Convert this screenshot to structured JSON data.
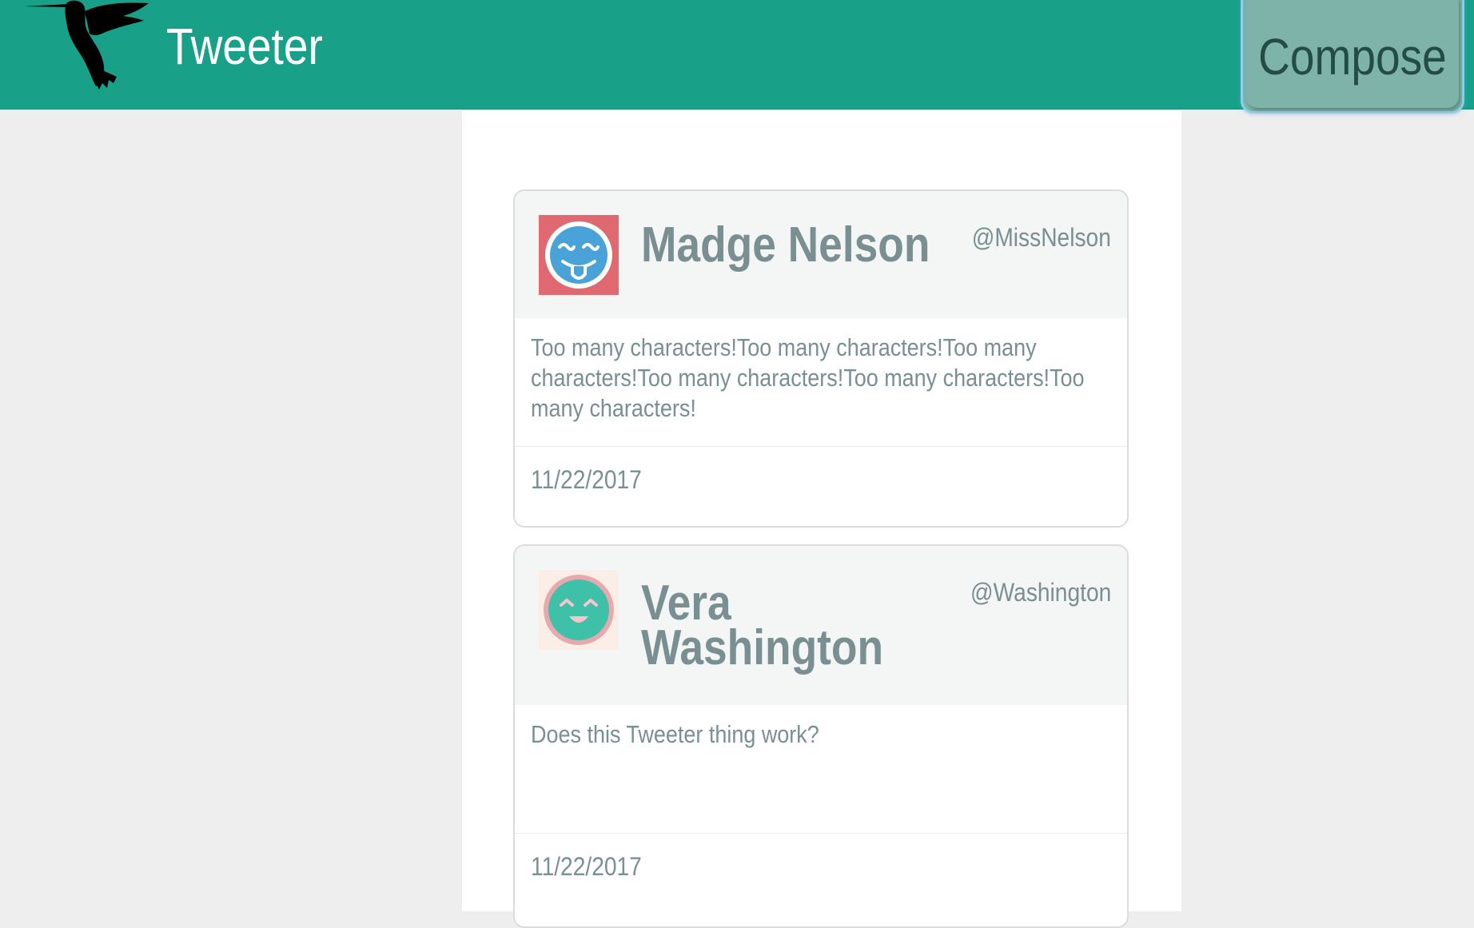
{
  "header": {
    "brand": "Tweeter",
    "compose_label": "Compose",
    "background_color": "#18a089"
  },
  "tweets": [
    {
      "name": "Madge Nelson",
      "handle": "@MissNelson",
      "text": "Too many characters!Too many characters!Too many characters!Too many characters!Too many characters!Too many characters!",
      "date": "11/22/2017",
      "avatar_icon": "tongue-out-face-icon",
      "avatar_colors": {
        "background": "#e06870",
        "face": "#4aa3d8"
      }
    },
    {
      "name": "Vera Washington",
      "handle": "@Washington",
      "text": "Does this Tweeter thing work?",
      "date": "11/22/2017",
      "avatar_icon": "smiling-face-icon",
      "avatar_colors": {
        "background": "#fbeee6",
        "face": "#3fc0a8"
      }
    }
  ]
}
